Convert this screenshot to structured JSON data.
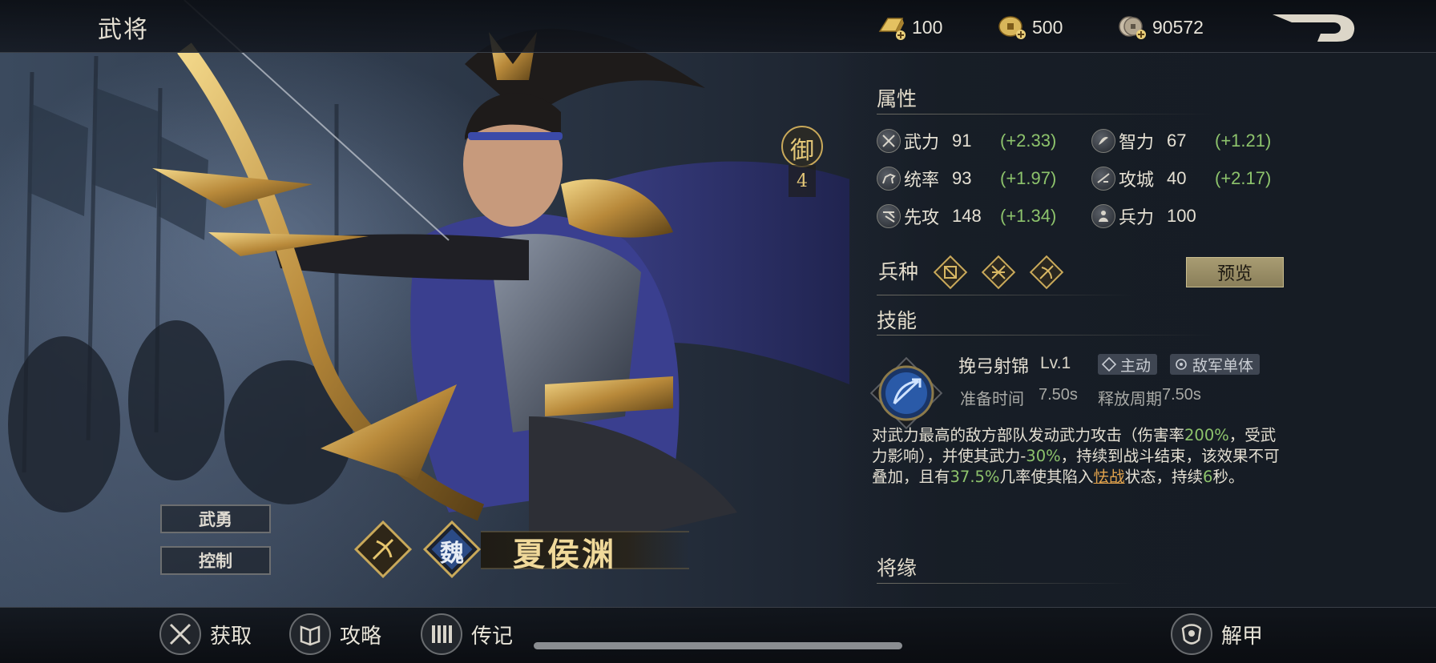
{
  "header": {
    "title": "武将",
    "resources": [
      {
        "icon": "gold-bar-icon",
        "value": "100"
      },
      {
        "icon": "gold-coin-icon",
        "value": "500"
      },
      {
        "icon": "copper-coin-icon",
        "value": "90572"
      }
    ],
    "back_icon": "back-arrow-icon"
  },
  "hero": {
    "name": "夏侯渊",
    "faction_glyph": "魏",
    "class_badge": {
      "label": "御",
      "value": "4"
    },
    "traits": [
      "武勇",
      "控制"
    ]
  },
  "attributes": {
    "title": "属性",
    "stats": [
      {
        "label": "武力",
        "value": "91",
        "bonus": "(+2.33)",
        "icon": "sword-icon"
      },
      {
        "label": "智力",
        "value": "67",
        "bonus": "(+1.21)",
        "icon": "scroll-icon"
      },
      {
        "label": "统率",
        "value": "93",
        "bonus": "(+1.97)",
        "icon": "horse-icon"
      },
      {
        "label": "攻城",
        "value": "40",
        "bonus": "(+2.17)",
        "icon": "siege-icon"
      },
      {
        "label": "先攻",
        "value": "148",
        "bonus": "(+1.34)",
        "icon": "speed-icon"
      },
      {
        "label": "兵力",
        "value": "100",
        "bonus": "",
        "icon": "soldier-icon"
      }
    ]
  },
  "troops": {
    "title": "兵种",
    "preview_label": "预览"
  },
  "skills": {
    "title": "技能",
    "name": "挽弓射锦",
    "level": "Lv.1",
    "tags": [
      "主动",
      "敌军单体"
    ],
    "prep_label": "准备时间",
    "prep_value": "7.50s",
    "cycle_label": "释放周期",
    "cycle_value": "7.50s",
    "desc": {
      "p1": "对武力最高的敌方部队发动武力攻击（伤害率",
      "p2": "200%",
      "p3": "，受武力影响），并使其武力-",
      "p4": "30%",
      "p5": "，持续到战斗结束，该效果不可叠加，且有",
      "p6": "37.5%",
      "p7": "几率使其陷入",
      "p8": "怯战",
      "p9": "状态，持续",
      "p10": "6",
      "p11": "秒。"
    }
  },
  "fate": {
    "title": "将缘"
  },
  "bottom": {
    "buttons": [
      {
        "label": "获取",
        "icon": "crossed-swords-icon"
      },
      {
        "label": "攻略",
        "icon": "book-icon"
      },
      {
        "label": "传记",
        "icon": "bamboo-scroll-icon"
      },
      {
        "label": "解甲",
        "icon": "armor-icon"
      }
    ]
  },
  "colors": {
    "bonus_green": "#8dc36c",
    "highlight_orange": "#e0a24c",
    "gold": "#c9a95a",
    "name_gold": "#f0d99a"
  }
}
